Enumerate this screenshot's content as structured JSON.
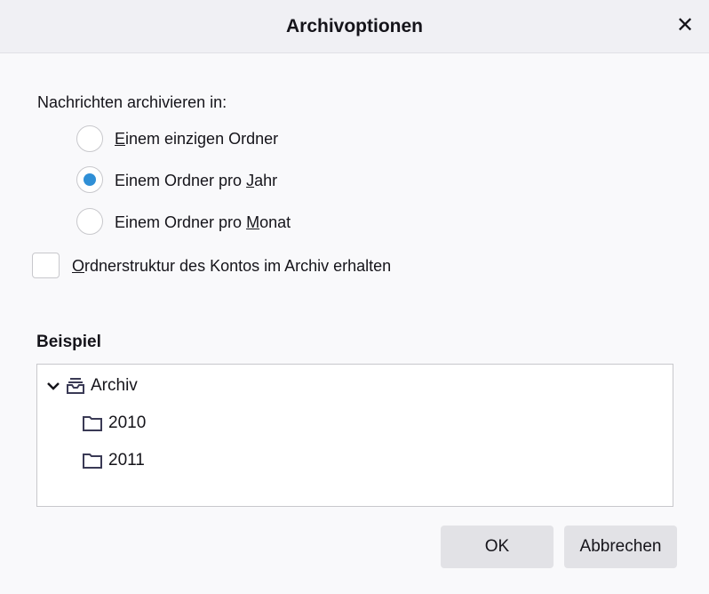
{
  "dialog": {
    "title": "Archivoptionen",
    "close_icon": "close-icon"
  },
  "archive_in": {
    "label": "Nachrichten archivieren in:",
    "options": [
      {
        "pre": "",
        "key": "E",
        "post": "inem einzigen Ordner",
        "selected": false
      },
      {
        "pre": "Einem Ordner pro ",
        "key": "J",
        "post": "ahr",
        "selected": true
      },
      {
        "pre": "Einem Ordner pro ",
        "key": "M",
        "post": "onat",
        "selected": false
      }
    ]
  },
  "keep_structure": {
    "pre": "",
    "key": "O",
    "post": "rdnerstruktur des Kontos im Archiv erhalten",
    "checked": false
  },
  "example": {
    "heading": "Beispiel",
    "root": "Archiv",
    "children": [
      "2010",
      "2011"
    ]
  },
  "buttons": {
    "ok": "OK",
    "cancel": "Abbrechen"
  },
  "colors": {
    "accent": "#2f8fd6"
  }
}
